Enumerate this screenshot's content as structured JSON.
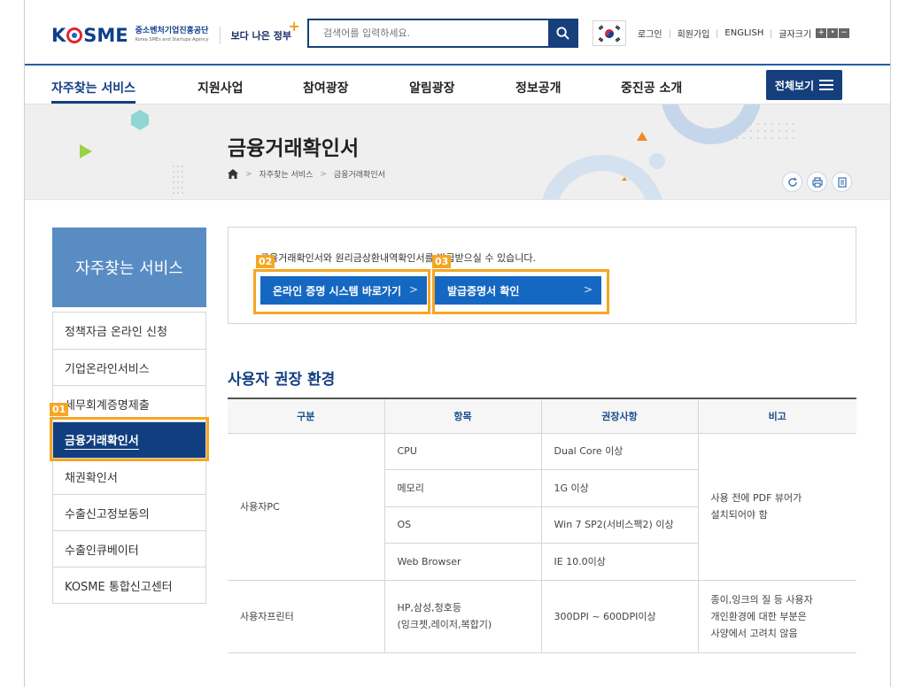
{
  "header": {
    "logo_word_left": "K",
    "logo_word_right": "SME",
    "logo_sub_ko": "중소벤처기업진흥공단",
    "logo_sub_en": "Korea SMEs and Startups Agency",
    "gov_slogan": "보다 나은 정부",
    "search_placeholder": "검색어를 입력하세요.",
    "util_links": [
      "로그인",
      "회원가입",
      "ENGLISH"
    ],
    "font_size_label": "글자크기",
    "font_size_buttons": [
      "+",
      "•",
      "−"
    ]
  },
  "gnb": {
    "items": [
      "자주찾는 서비스",
      "지원사업",
      "참여광장",
      "알림광장",
      "정보공개",
      "중진공 소개"
    ],
    "active_index": 0,
    "all_menu_label": "전체보기"
  },
  "visual": {
    "page_title": "금융거래확인서",
    "breadcrumb": [
      "자주찾는 서비스",
      "금융거래확인서"
    ]
  },
  "sidebar": {
    "title": "자주찾는 서비스",
    "items": [
      "정책자금 온라인 신청",
      "기업온라인서비스",
      "세무회계증명제출",
      "금융거래확인서",
      "채권확인서",
      "수출신고정보동의",
      "수출인큐베이터",
      "KOSME 통합신고센터"
    ],
    "active_index": 3
  },
  "highlights": {
    "tag1": "01",
    "tag2": "02",
    "tag3": "03"
  },
  "content": {
    "info_text": "금융거래확인서와 원리금상환내역확인서를 발급받으실 수 있습니다.",
    "btn_online": "온라인 증명 시스템 바로가기",
    "btn_verify": "발급증명서 확인",
    "section_title": "사용자 권장 환경",
    "table": {
      "headers": [
        "구분",
        "항목",
        "권장사항",
        "비고"
      ],
      "pc_label": "사용자PC",
      "pc_rows": [
        [
          "CPU",
          "Dual Core 이상"
        ],
        [
          "메모리",
          "1G 이상"
        ],
        [
          "OS",
          "Win 7 SP2(서비스팩2) 이상"
        ],
        [
          "Web Browser",
          "IE 10.0이상"
        ]
      ],
      "pc_note_1": "사용 전에 PDF 뷰어가",
      "pc_note_2": "설치되어야 함",
      "printer_label": "사용자프린터",
      "printer_item_1": "HP,삼성,청호등",
      "printer_item_2": "(잉크젯,레이저,복합기)",
      "printer_spec": "300DPI ~ 600DPI이상",
      "printer_note_1": "종이,잉크의 질 등 사용자",
      "printer_note_2": "개인환경에 대한 부분은",
      "printer_note_3": "사양에서 고려치 않음"
    }
  },
  "colors": {
    "brand_navy": "#133f85",
    "button_blue": "#1568c1",
    "sidebar_head": "#5a8cc4",
    "highlight_orange": "#f5a623"
  }
}
